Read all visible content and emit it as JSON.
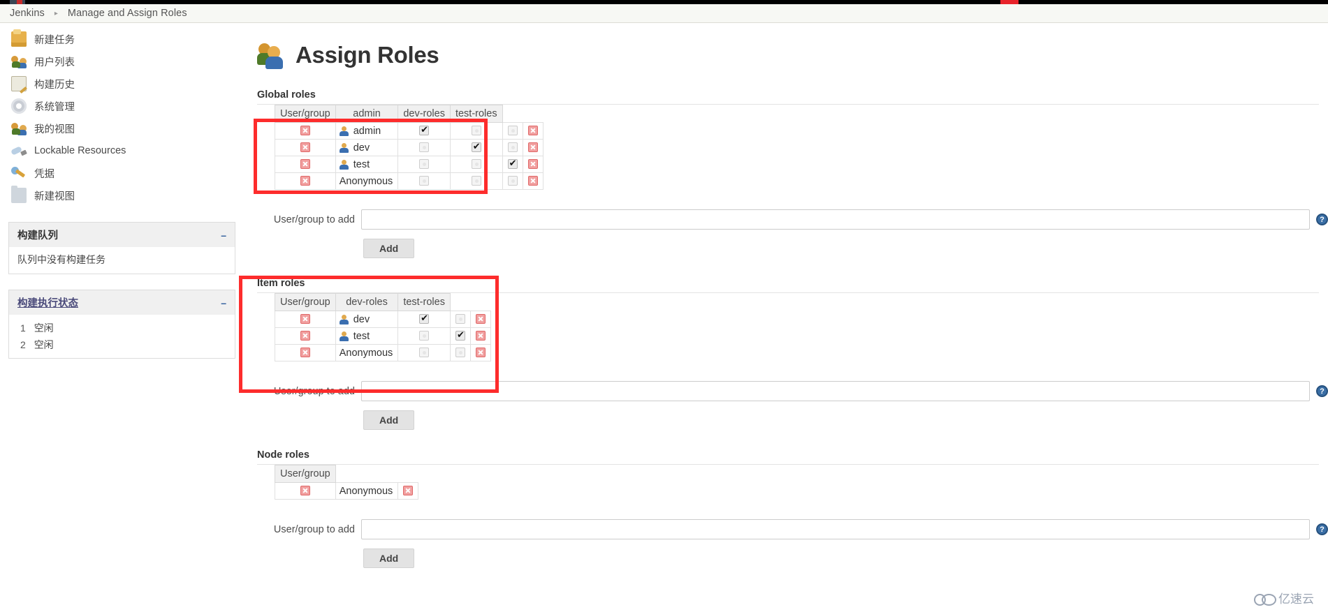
{
  "breadcrumb": {
    "root": "Jenkins",
    "separator": "▸",
    "current": "Manage and Assign Roles"
  },
  "sidebar": {
    "tasks": [
      {
        "label": "新建任务",
        "icon": "new-job-icon"
      },
      {
        "label": "用户列表",
        "icon": "people-icon"
      },
      {
        "label": "构建历史",
        "icon": "build-history-icon"
      },
      {
        "label": "系统管理",
        "icon": "gear-icon"
      },
      {
        "label": "我的视图",
        "icon": "my-views-icon"
      },
      {
        "label": "Lockable Resources",
        "icon": "lock-icon"
      },
      {
        "label": "凭据",
        "icon": "credentials-icon"
      },
      {
        "label": "新建视图",
        "icon": "folder-icon"
      }
    ],
    "build_queue": {
      "title": "构建队列",
      "collapse": "–",
      "empty_text": "队列中没有构建任务"
    },
    "build_executor": {
      "title": "构建执行状态",
      "collapse": "–",
      "executors": [
        {
          "num": "1",
          "status": "空闲"
        },
        {
          "num": "2",
          "status": "空闲"
        }
      ]
    }
  },
  "main": {
    "page_title": "Assign Roles",
    "page_icon": "assign-roles-icon",
    "help_icon_label": "?",
    "global_roles": {
      "heading": "Global roles",
      "columns": [
        "User/group",
        "admin",
        "dev-roles",
        "test-roles"
      ],
      "rows": [
        {
          "name": "admin",
          "has_user_icon": true,
          "checks": [
            true,
            false,
            false
          ]
        },
        {
          "name": "dev",
          "has_user_icon": true,
          "checks": [
            false,
            true,
            false
          ]
        },
        {
          "name": "test",
          "has_user_icon": true,
          "checks": [
            false,
            false,
            true
          ]
        },
        {
          "name": "Anonymous",
          "has_user_icon": false,
          "checks": [
            false,
            false,
            false
          ]
        }
      ],
      "add_label": "User/group to add",
      "add_value": "",
      "add_placeholder": "",
      "add_button": "Add"
    },
    "item_roles": {
      "heading": "Item roles",
      "columns": [
        "User/group",
        "dev-roles",
        "test-roles"
      ],
      "rows": [
        {
          "name": "dev",
          "has_user_icon": true,
          "checks": [
            true,
            false
          ]
        },
        {
          "name": "test",
          "has_user_icon": true,
          "checks": [
            false,
            true
          ]
        },
        {
          "name": "Anonymous",
          "has_user_icon": false,
          "checks": [
            false,
            false
          ]
        }
      ],
      "add_label": "User/group to add",
      "add_value": "",
      "add_placeholder": "",
      "add_button": "Add"
    },
    "node_roles": {
      "heading": "Node roles",
      "columns": [
        "User/group"
      ],
      "rows": [
        {
          "name": "Anonymous",
          "has_user_icon": false,
          "checks": []
        }
      ],
      "add_label": "User/group to add",
      "add_value": "",
      "add_placeholder": "",
      "add_button": "Add"
    }
  },
  "watermark": {
    "text": "亿速云"
  },
  "colors": {
    "highlight_red": "#fd2c2c",
    "help_blue": "#3a6ea5",
    "header_gray": "#f0f0f0"
  }
}
